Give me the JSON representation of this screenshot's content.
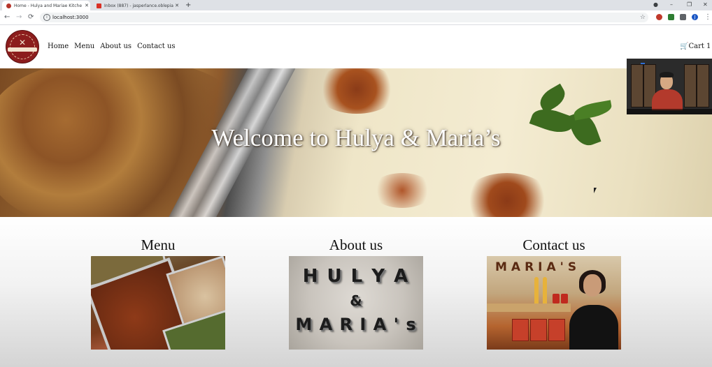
{
  "browser": {
    "tabs": [
      {
        "title": "Home - Hulya and Mariae Kitche",
        "active": true,
        "favicon_color": "#b5342a"
      },
      {
        "title": "Inbox (887) - jasperlance.oblepia",
        "active": false,
        "favicon_color": "#d93025"
      }
    ],
    "new_tab": "+",
    "window_controls": {
      "minimize": "–",
      "restore": "❐",
      "close": "✕"
    },
    "nav": {
      "back": "←",
      "forward": "→",
      "reload": "⟳"
    },
    "url": "localhost:3000",
    "star": "☆",
    "profile_initial": "J"
  },
  "site": {
    "logo_alt": "Hulya & Maria's logo",
    "nav": {
      "home": "Home",
      "menu": "Menu",
      "about": "About us",
      "contact": "Contact us"
    },
    "cart": "🛒Cart 1"
  },
  "hero": {
    "caption": "Welcome to Hulya & Maria’s"
  },
  "cards": {
    "menu": {
      "title": "Menu"
    },
    "about": {
      "title": "About us",
      "sign_line1": "H U L Y A",
      "sign_line2": "&",
      "sign_line3": "M A R I A ' s"
    },
    "contact": {
      "title": "Contact us",
      "brand": "MARIA'S"
    }
  },
  "colors": {
    "logo_red": "#8c1d1d",
    "hero_text": "#ffffff",
    "tab_bar": "#dee1e6"
  },
  "icons": [
    "info-icon",
    "star-icon",
    "cart-icon",
    "back-icon",
    "forward-icon",
    "reload-icon"
  ]
}
